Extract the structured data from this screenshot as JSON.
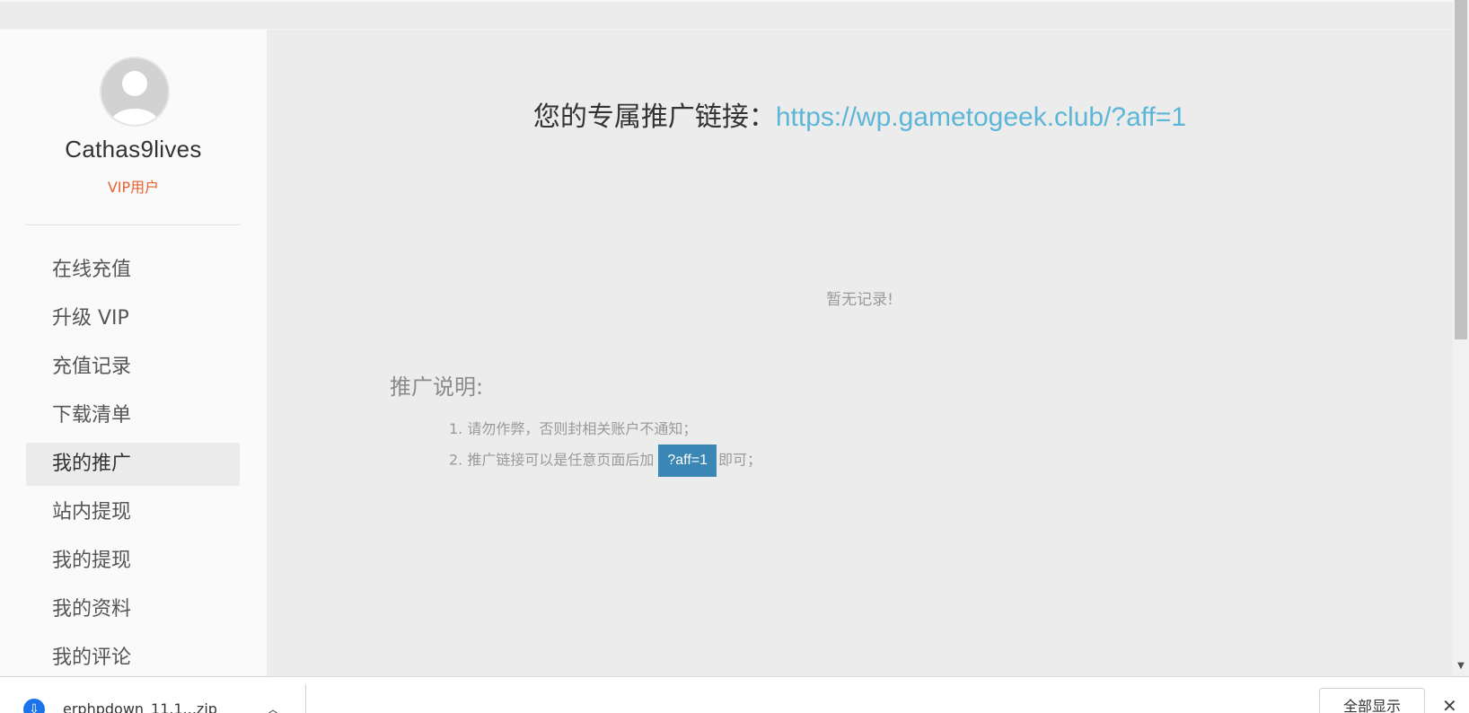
{
  "sidebar": {
    "username": "Cathas9lives",
    "vip_label": "VIP用户",
    "menu": [
      {
        "label": "在线充值"
      },
      {
        "label": "升级 VIP"
      },
      {
        "label": "充值记录"
      },
      {
        "label": "下载清单"
      },
      {
        "label": "我的推广",
        "active": true
      },
      {
        "label": "站内提现"
      },
      {
        "label": "我的提现"
      },
      {
        "label": "我的资料"
      },
      {
        "label": "我的评论"
      }
    ]
  },
  "main": {
    "link_prefix": "您的专属推广链接：",
    "link_url": "https://wp.gametogeek.club/?aff=1",
    "empty_note": "暂无记录!",
    "promo_title": "推广说明:",
    "rule_1": "1. 请勿作弊，否则封相关账户不通知；",
    "rule_2_before": "2. 推广链接可以是任意页面后加",
    "rule_2_code": "?aff=1",
    "rule_2_after": "即可；"
  },
  "download_bar": {
    "file_name": "erphpdown_11.1...zip",
    "show_all_label": "全部显示",
    "close_symbol": "✕"
  },
  "colors": {
    "accent_link": "#5bb6d8",
    "vip": "#e6622f",
    "code_badge": "#3a86b4"
  }
}
